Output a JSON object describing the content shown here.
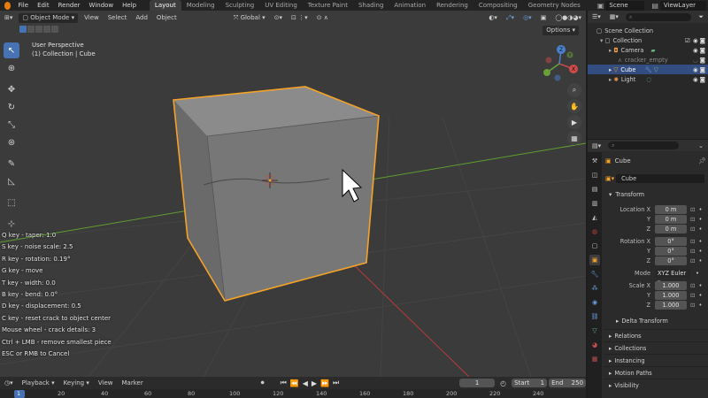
{
  "topbar": {
    "menus": [
      "File",
      "Edit",
      "Render",
      "Window",
      "Help"
    ],
    "workspaces": [
      "Layout",
      "Modeling",
      "Sculpting",
      "UV Editing",
      "Texture Paint",
      "Shading",
      "Animation",
      "Rendering",
      "Compositing",
      "Geometry Nodes"
    ],
    "active_workspace": "Layout",
    "scene": "Scene",
    "view_layer": "ViewLayer"
  },
  "viewport": {
    "header": {
      "mode": "Object Mode",
      "menus": [
        "View",
        "Select",
        "Add",
        "Object"
      ],
      "transform_orientation": "Global",
      "options_label": "Options"
    },
    "overlay_title": "User Perspective",
    "overlay_subtitle": "(1) Collection | Cube",
    "gizmo_axes": [
      "X",
      "Y",
      "Z"
    ],
    "hints": [
      "Q key - taper: 1.0",
      "S key - noise scale:  2.5",
      "R key - rotation:  0.19°",
      "G key - move",
      "T key - width:  0.0",
      "B key - bend:  0.0°",
      "D key - displacement:  0.5",
      "C key - reset crack to object center",
      "Mouse wheel - crack details:  3",
      "Ctrl + LMB - remove smallest piece",
      "ESC or RMB to Cancel"
    ],
    "colors": {
      "selection_outline": "#f5a228",
      "x_axis": "#b53a3a",
      "y_axis": "#5e9e2e",
      "background": "#3b3b3b"
    }
  },
  "timeline": {
    "menus": [
      "Playback",
      "Keying",
      "View",
      "Marker"
    ],
    "current_frame": "1",
    "start_label": "Start",
    "start": "1",
    "end_label": "End",
    "end": "250",
    "ruler": [
      "1",
      "20",
      "40",
      "60",
      "80",
      "100",
      "120",
      "140",
      "160",
      "180",
      "200",
      "220",
      "240"
    ]
  },
  "outliner": {
    "rows": [
      {
        "name": "Scene Collection",
        "level": 0,
        "icon": "collection-icon"
      },
      {
        "name": "Collection",
        "level": 1,
        "icon": "collection-icon"
      },
      {
        "name": "Camera",
        "level": 2,
        "icon": "camera-icon"
      },
      {
        "name": "cracker_empty",
        "level": 2,
        "icon": "empty-icon",
        "dim": true
      },
      {
        "name": "Cube",
        "level": 2,
        "icon": "mesh-icon",
        "selected": true
      },
      {
        "name": "Light",
        "level": 2,
        "icon": "light-icon"
      }
    ]
  },
  "properties": {
    "object_name": "Cube",
    "data_name": "Cube",
    "transform_header": "Transform",
    "location": {
      "label": "Location X",
      "x": "0 m",
      "y": "0 m",
      "z": "0 m"
    },
    "rotation": {
      "label": "Rotation X",
      "x": "0°",
      "y": "0°",
      "z": "0°"
    },
    "mode_label": "Mode",
    "mode_value": "XYZ Euler",
    "scale": {
      "label": "Scale X",
      "x": "1.000",
      "y": "1.000",
      "z": "1.000"
    },
    "y_label": "Y",
    "z_label": "Z",
    "sections": [
      "Delta Transform",
      "Relations",
      "Collections",
      "Instancing",
      "Motion Paths",
      "Visibility"
    ]
  }
}
